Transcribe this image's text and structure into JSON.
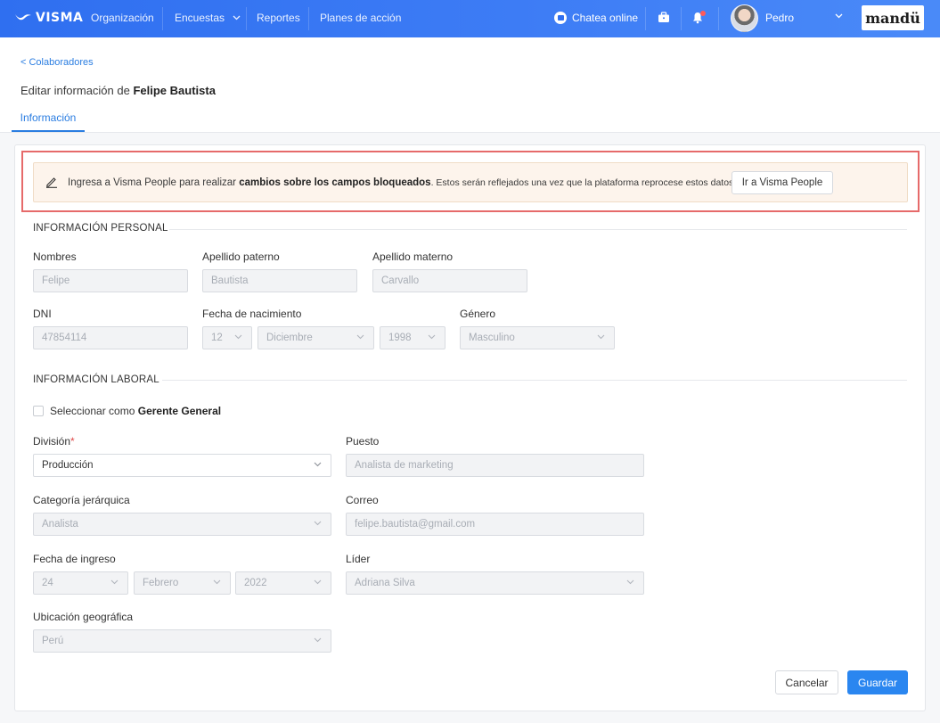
{
  "topbar": {
    "logo_text": "VISMA",
    "nav": [
      {
        "label": "Organización"
      },
      {
        "label": "Encuestas"
      },
      {
        "label": "Reportes"
      },
      {
        "label": "Planes de acción"
      }
    ],
    "chat_label": "Chatea online",
    "notification_count": "1",
    "user_name": "Pedro",
    "brand": "mandü",
    "icons": [
      "briefcase-icon",
      "bell-icon",
      "chevron-down-icon",
      "chat-bubble-icon"
    ]
  },
  "header": {
    "breadcrumb": "< Colaboradores",
    "title_prefix": "Editar información de",
    "title_name": "Felipe Bautista",
    "tab_label": "Información"
  },
  "alert": {
    "text_prefix": "Ingresa a Visma People para realizar",
    "text_bold": "cambios sobre los campos bloqueados",
    "text_suffix": ". Estos serán reflejados una vez que la plataforma reprocese estos datos.",
    "button_label": "Ir a Visma People",
    "border_color": "#e66a6a"
  },
  "personal": {
    "section_title": "INFORMACIÓN PERSONAL",
    "nombres_label": "Nombres",
    "nombres_value": "Felipe",
    "apellido_paterno_label": "Apellido paterno",
    "apellido_paterno_value": "Bautista",
    "apellido_materno_label": "Apellido materno",
    "apellido_materno_value": "Carvallo",
    "dni_label": "DNI",
    "dni_value": "47854114",
    "nacimiento_label": "Fecha de nacimiento",
    "nacimiento_dia": "12",
    "nacimiento_mes": "Diciembre",
    "nacimiento_anio": "1998",
    "genero_label": "Género",
    "genero_value": "Masculino"
  },
  "laboral": {
    "section_title": "INFORMACIÓN LABORAL",
    "gerente_prefix": "Seleccionar como",
    "gerente_bold": "Gerente General",
    "division_label": "División",
    "division_required": "*",
    "division_value": "Producción",
    "puesto_label": "Puesto",
    "puesto_value": "Analista de marketing",
    "categoria_label": "Categoría jerárquica",
    "categoria_value": "Analista",
    "correo_label": "Correo",
    "correo_value": "felipe.bautista@gmail.com",
    "ingreso_label": "Fecha de ingreso",
    "ingreso_dia": "24",
    "ingreso_mes": "Febrero",
    "ingreso_anio": "2022",
    "lider_label": "Líder",
    "lider_value": "Adriana Silva",
    "ubicacion_label": "Ubicación geográfica",
    "ubicacion_value": "Perú"
  },
  "actions": {
    "cancel_label": "Cancelar",
    "save_label": "Guardar",
    "primary_color": "#2a86f0"
  }
}
